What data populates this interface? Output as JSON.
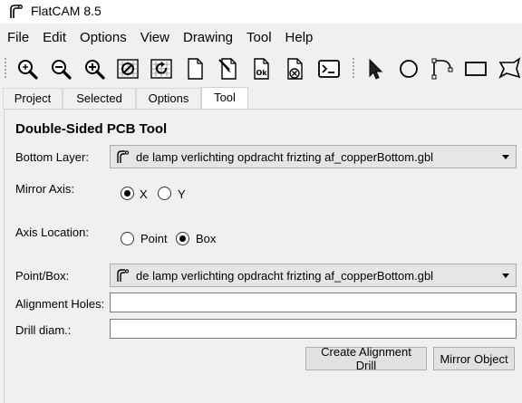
{
  "window": {
    "title": "FlatCAM 8.5",
    "logo_icon": "flatcam-logo-icon"
  },
  "menu": [
    "File",
    "Edit",
    "Options",
    "View",
    "Drawing",
    "Tool",
    "Help"
  ],
  "toolbar": {
    "buttons": [
      "zoom-fit-icon",
      "zoom-out-icon",
      "zoom-in-icon",
      "clear-plot-icon",
      "replot-icon",
      "new-document-icon",
      "edit-document-icon",
      "ok-document-icon",
      "delete-document-icon",
      "shell-icon",
      "select-pointer-icon",
      "circle-icon",
      "arc-icon",
      "rectangle-icon",
      "polygon-icon"
    ]
  },
  "tabs": [
    {
      "label": "Project",
      "active": false
    },
    {
      "label": "Selected",
      "active": false
    },
    {
      "label": "Options",
      "active": false
    },
    {
      "label": "Tool",
      "active": true
    }
  ],
  "tool": {
    "title": "Double-Sided PCB Tool",
    "bottom_layer": {
      "label": "Bottom Layer:",
      "value": "de lamp verlichting opdracht frizting af_copperBottom.gbl"
    },
    "mirror_axis": {
      "label": "Mirror Axis:",
      "options": [
        "X",
        "Y"
      ],
      "selected": "X"
    },
    "axis_location": {
      "label": "Axis Location:",
      "options": [
        "Point",
        "Box"
      ],
      "selected": "Box"
    },
    "point_box": {
      "label": "Point/Box:",
      "value": "de lamp verlichting opdracht frizting af_copperBottom.gbl"
    },
    "alignment_holes": {
      "label": "Alignment Holes:",
      "value": ""
    },
    "drill_diam": {
      "label": "Drill diam.:",
      "value": ""
    },
    "create_button": "Create Alignment Drill",
    "mirror_button": "Mirror Object"
  },
  "colors": {
    "background": "#f0f0f0",
    "active_tab": "#ffffff",
    "combo_bg": "#e5e5e5"
  }
}
